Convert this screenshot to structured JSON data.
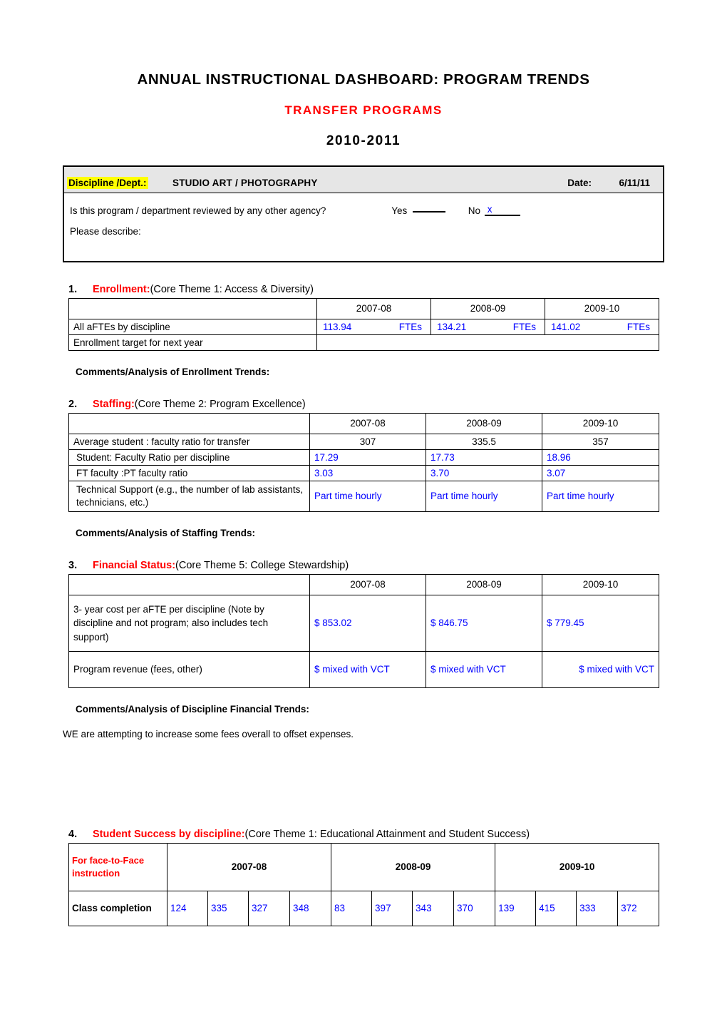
{
  "document": {
    "title": "ANNUAL INSTRUCTIONAL DASHBOARD: PROGRAM TRENDS",
    "subtitle": "TRANSFER PROGRAMS",
    "year": "2010-2011",
    "accent_red": "#FF0000",
    "accent_blue": "#0000FF",
    "highlight_yellow": "#FFFF00"
  },
  "header_box": {
    "discipline_label": "Discipline /Dept.:",
    "discipline_value": "STUDIO ART / PHOTOGRAPHY",
    "date_label": "Date:",
    "date_value": "6/11/11",
    "review_question": "Is this program / department reviewed by any other agency?",
    "yes_label": "Yes",
    "yes_value": "",
    "no_label": "No",
    "no_value": "x",
    "describe_label": "Please describe:",
    "describe_value": ""
  },
  "sections": {
    "enrollment": {
      "number": "1.",
      "title": "Enrollment:",
      "subtitle": "(Core Theme 1: Access & Diversity)",
      "years": [
        "2007-08",
        "2008-09",
        "2009-10"
      ],
      "rows": [
        {
          "label": "All aFTEs by discipline",
          "values": [
            "113.94",
            "134.21",
            "141.02"
          ],
          "units": [
            "FTEs",
            "FTEs",
            "FTEs"
          ]
        },
        {
          "label": "Enrollment target for next year",
          "merged_value": ""
        }
      ],
      "comments_label": "Comments/Analysis of Enrollment Trends:",
      "comments_value": ""
    },
    "staffing": {
      "number": "2.",
      "title": "Staffing:",
      "subtitle": "(Core Theme 2:  Program Excellence)",
      "years": [
        "2007-08",
        "2008-09",
        "2009-10"
      ],
      "rows": [
        {
          "label": "Average student : faculty ratio for transfer",
          "values": [
            "307",
            "335.5",
            "357"
          ],
          "style": "bold-center"
        },
        {
          "label": "Student: Faculty Ratio per discipline",
          "values": [
            "17.29",
            "17.73",
            "18.96"
          ],
          "style": "blue"
        },
        {
          "label": "FT faculty :PT faculty ratio",
          "values": [
            "3.03",
            "3.70",
            "3.07"
          ],
          "style": "blue"
        },
        {
          "label": "Technical Support (e.g., the number of lab assistants, technicians, etc.)",
          "values": [
            "Part time hourly",
            "Part time hourly",
            "Part time hourly"
          ],
          "style": "blue"
        }
      ],
      "comments_label": "Comments/Analysis of Staffing Trends:",
      "comments_value": ""
    },
    "financial": {
      "number": "3.",
      "title": "Financial Status:",
      "subtitle": "(Core Theme 5:  College Stewardship)",
      "years": [
        "2007-08",
        "2008-09",
        "2009-10"
      ],
      "rows": [
        {
          "label": "3- year cost per aFTE per discipline (Note by discipline and not program; also includes tech support)",
          "values": [
            "$  853.02",
            "$ 846.75",
            "$ 779.45"
          ],
          "style": "blue"
        },
        {
          "label": "Program revenue (fees, other)",
          "values": [
            "$  mixed with VCT",
            "$ mixed with VCT",
            "$ mixed with VCT"
          ],
          "style": "blue"
        }
      ],
      "comments_label": "Comments/Analysis of Discipline Financial Trends:",
      "comments_value": "WE are attempting to increase some fees overall to offset expenses."
    },
    "student_success": {
      "number": "4.",
      "title": "Student Success by discipline:",
      "subtitle": "(Core Theme 1: Educational Attainment and Student Success)",
      "corner_label": "For face-to-Face instruction",
      "years": [
        "2007-08",
        "2008-09",
        "2009-10"
      ],
      "row_label": "Class completion",
      "values": [
        "124",
        "335",
        "327",
        "348",
        "83",
        "397",
        "343",
        "370",
        "139",
        "415",
        "333",
        "372"
      ]
    }
  }
}
